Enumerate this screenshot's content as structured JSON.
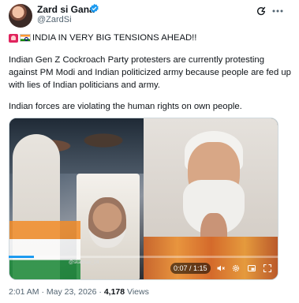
{
  "author": {
    "display_name": "Zard si Gana",
    "handle": "@ZardSi"
  },
  "post": {
    "headline": "INDIA IN VERY BIG TENSIONS AHEAD!!",
    "paragraph1": "Indian Gen Z Cockroach Party protesters are currently protesting against PM Modi and Indian politicized army because people are fed up with lies of Indian politicians and army.",
    "paragraph2": "Indian forces are violating the human rights on own people."
  },
  "media": {
    "watermark": "@skabraw_24",
    "time": "0:07 / 1:15",
    "progress": 0.093
  },
  "meta": {
    "timestamp": "2:01 AM · May 23, 2026 · ",
    "views_count": "4,178",
    "views_label": " Views"
  },
  "colors": {
    "accent": "#1d9bf0",
    "text": "#0f1419",
    "secondary": "#536471"
  },
  "icons": [
    "verified-badge-icon",
    "grok-icon",
    "more-options-icon",
    "siren-emoji-icon",
    "india-flag-icon",
    "mute-icon",
    "settings-icon",
    "pip-icon",
    "fullscreen-icon"
  ]
}
